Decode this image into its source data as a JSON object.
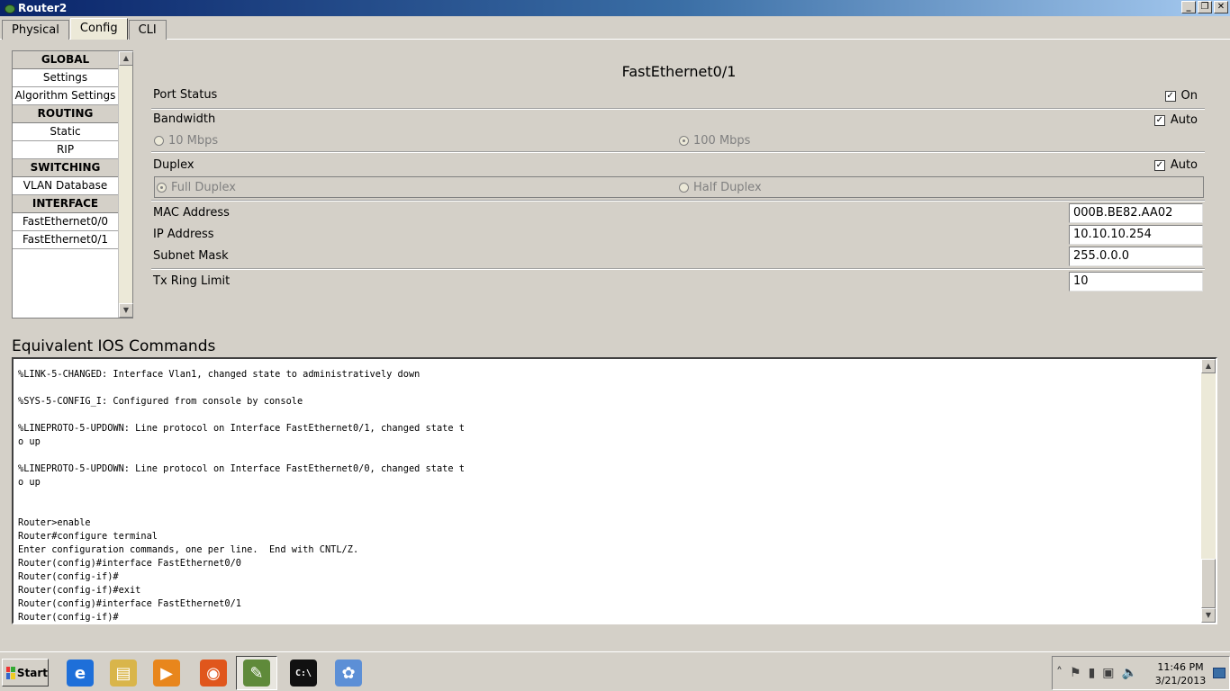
{
  "window": {
    "title": "Router2"
  },
  "tabs": [
    {
      "label": "Physical",
      "active": false
    },
    {
      "label": "Config",
      "active": true
    },
    {
      "label": "CLI",
      "active": false
    }
  ],
  "nav": {
    "items": [
      {
        "label": "GLOBAL",
        "header": true
      },
      {
        "label": "Settings",
        "header": false
      },
      {
        "label": "Algorithm Settings",
        "header": false
      },
      {
        "label": "ROUTING",
        "header": true
      },
      {
        "label": "Static",
        "header": false
      },
      {
        "label": "RIP",
        "header": false
      },
      {
        "label": "SWITCHING",
        "header": true
      },
      {
        "label": "VLAN Database",
        "header": false
      },
      {
        "label": "INTERFACE",
        "header": true
      },
      {
        "label": "FastEthernet0/0",
        "header": false
      },
      {
        "label": "FastEthernet0/1",
        "header": false
      }
    ]
  },
  "config": {
    "title": "FastEthernet0/1",
    "port_status": {
      "label": "Port Status",
      "check_label": "On",
      "checked": true
    },
    "bandwidth": {
      "label": "Bandwidth",
      "check_label": "Auto",
      "checked": true,
      "opt_10": "10 Mbps",
      "opt_100": "100 Mbps"
    },
    "duplex": {
      "label": "Duplex",
      "check_label": "Auto",
      "checked": true,
      "opt_full": "Full Duplex",
      "opt_half": "Half Duplex"
    },
    "mac": {
      "label": "MAC Address",
      "value": "000B.BE82.AA02"
    },
    "ip": {
      "label": "IP Address",
      "value": "10.10.10.254"
    },
    "subnet": {
      "label": "Subnet Mask",
      "value": "255.0.0.0"
    },
    "tx_ring": {
      "label": "Tx Ring Limit",
      "value": "10"
    }
  },
  "ios": {
    "title": "Equivalent IOS Commands",
    "text": "%LINK-5-CHANGED: Interface Vlan1, changed state to administratively down\n\n%SYS-5-CONFIG_I: Configured from console by console\n\n%LINEPROTO-5-UPDOWN: Line protocol on Interface FastEthernet0/1, changed state t\no up\n\n%LINEPROTO-5-UPDOWN: Line protocol on Interface FastEthernet0/0, changed state t\no up\n\n\nRouter>enable\nRouter#configure terminal\nEnter configuration commands, one per line.  End with CNTL/Z.\nRouter(config)#interface FastEthernet0/0\nRouter(config-if)#\nRouter(config-if)#exit\nRouter(config)#interface FastEthernet0/1\nRouter(config-if)#"
  },
  "taskbar": {
    "start_label": "Start",
    "apps": [
      {
        "name": "internet-explorer",
        "glyph": "e",
        "color": "#1e6fd9"
      },
      {
        "name": "file-explorer",
        "glyph": "▤",
        "color": "#d9b54a"
      },
      {
        "name": "media-player",
        "glyph": "▶",
        "color": "#e8861c"
      },
      {
        "name": "firefox",
        "glyph": "◉",
        "color": "#e0561c"
      },
      {
        "name": "packet-tracer",
        "glyph": "✎",
        "color": "#5f8a3a"
      },
      {
        "name": "command-prompt",
        "glyph": "C:\\",
        "color": "#111111"
      },
      {
        "name": "paint",
        "glyph": "✿",
        "color": "#5c8fd6"
      }
    ],
    "time": "11:46 PM",
    "date": "3/21/2013"
  }
}
